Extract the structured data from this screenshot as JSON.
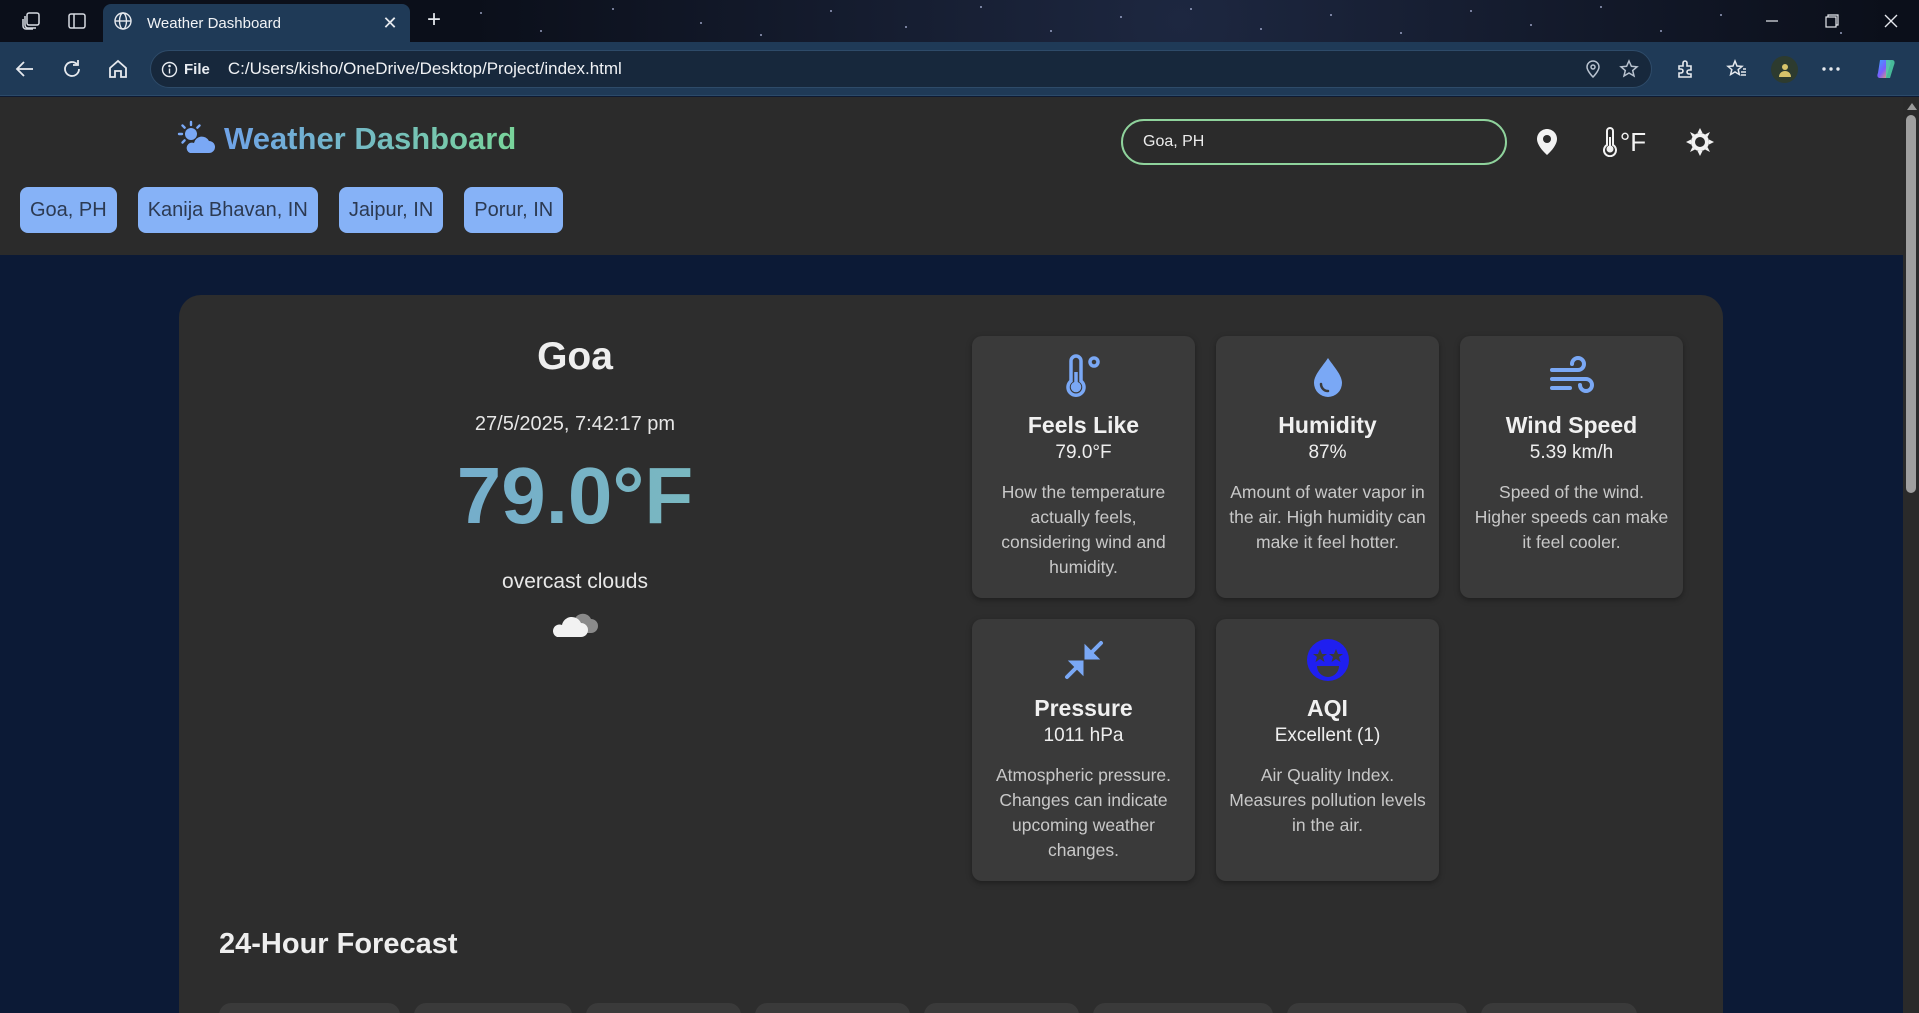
{
  "browser": {
    "tab_title": "Weather Dashboard",
    "address_prefix": "File",
    "address_url": "C:/Users/kisho/OneDrive/Desktop/Project/index.html"
  },
  "header": {
    "title": "Weather Dashboard",
    "search_value": "Goa, PH",
    "unit_label": "°F"
  },
  "recent_cities": [
    "Goa, PH",
    "Kanija Bhavan, IN",
    "Jaipur, IN",
    "Porur, IN"
  ],
  "current": {
    "city": "Goa",
    "datetime": "27/5/2025, 7:42:17 pm",
    "temperature": "79.0°F",
    "condition": "overcast clouds",
    "condition_icon": "cloud-icon"
  },
  "metrics": {
    "feels_like": {
      "title": "Feels Like",
      "value": "79.0°F",
      "desc": "How the temperature actually feels, considering wind and humidity.",
      "icon": "thermometer-icon"
    },
    "humidity": {
      "title": "Humidity",
      "value": "87%",
      "desc": "Amount of water vapor in the air. High humidity can make it feel hotter.",
      "icon": "droplet-icon"
    },
    "wind_speed": {
      "title": "Wind Speed",
      "value": "5.39 km/h",
      "desc": "Speed of the wind. Higher speeds can make it feel cooler.",
      "icon": "wind-icon"
    },
    "pressure": {
      "title": "Pressure",
      "value": "1011 hPa",
      "desc": "Atmospheric pressure. Changes can indicate upcoming weather changes.",
      "icon": "compress-icon"
    },
    "aqi": {
      "title": "AQI",
      "value": "Excellent (1)",
      "desc": "Air Quality Index. Measures pollution levels in the air.",
      "icon": "smile-icon"
    }
  },
  "forecast": {
    "title": "24-Hour Forecast"
  },
  "colors": {
    "accent_blue": "#86b2f7",
    "accent_green": "#8fd39c",
    "icon_blue": "#7aa8f5",
    "aqi_blue": "#1f1ff0"
  }
}
